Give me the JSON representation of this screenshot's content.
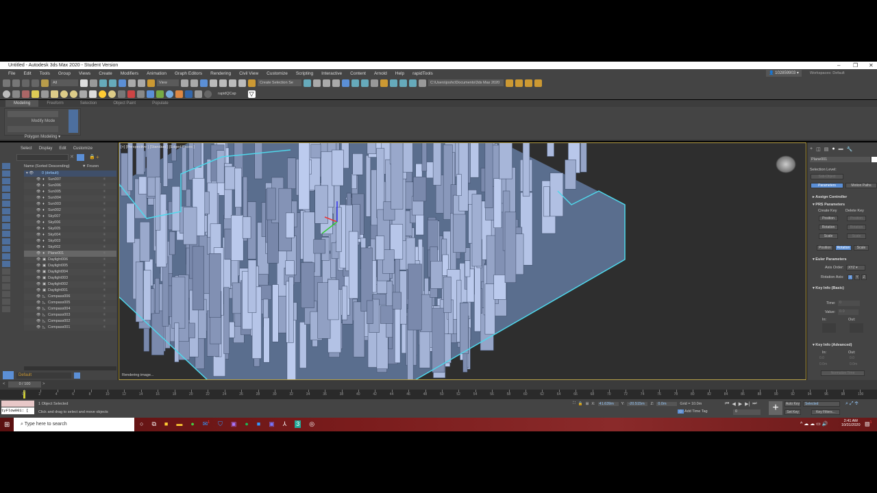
{
  "window": {
    "title": "Untitled - Autodesk 3ds Max 2020 - Student Version",
    "minimize": "–",
    "restore": "❐",
    "close": "✕"
  },
  "menu": [
    "File",
    "Edit",
    "Tools",
    "Group",
    "Views",
    "Create",
    "Modifiers",
    "Animation",
    "Graph Editors",
    "Rendering",
    "Civil View",
    "Customize",
    "Scripting",
    "Interactive",
    "Content",
    "Arnold",
    "Help",
    "rapidTools"
  ],
  "account": {
    "user": "102859903",
    "workspaces_label": "Workspaces:",
    "workspace": "Default"
  },
  "toolbar": {
    "selection_filter": "All",
    "ref_coord": "View",
    "named_selection": "Create Selection Se",
    "project_path": "C:\\Users\\joshc\\Documents\\3ds Max 2020",
    "rapid_label": "rapidQCap"
  },
  "ribbon": {
    "tabs": [
      "Modeling",
      "Freeform",
      "Selection",
      "Object Paint",
      "Populate"
    ],
    "panel_title": "Modify Mode",
    "footer": "Polygon Modeling"
  },
  "explorer": {
    "menu": [
      "Select",
      "Display",
      "Edit",
      "Customize"
    ],
    "col_name": "Name (Sorted Descending)",
    "col_frozen": "Frozen",
    "layer": "0 (default)",
    "items": [
      "Sun007",
      "Sun006",
      "Sun005",
      "Sun004",
      "Sun003",
      "Sun002",
      "Sky007",
      "Sky006",
      "Sky005",
      "Sky004",
      "Sky003",
      "Sky002",
      "Plane001",
      "Daylight006",
      "Daylight005",
      "Daylight004",
      "Daylight003",
      "Daylight002",
      "Daylight001",
      "Compass006",
      "Compass005",
      "Compass004",
      "Compass003",
      "Compass002",
      "Compass001"
    ],
    "selected": "Plane001",
    "layer_footer": "Default"
  },
  "viewport": {
    "label": "[+] [Perspective ] [Standard ] [Edged Faces ]",
    "status": "Rendering image..."
  },
  "command_panel": {
    "object_name": "Plane001",
    "selection_level": "Selection Level:",
    "sub_object": "Sub-Object",
    "tab_parameters": "Parameters",
    "tab_motion_paths": "Motion Paths",
    "assign_controller": "Assign Controller",
    "prs": "PRS Parameters",
    "create_key": "Create Key",
    "delete_key": "Delete Key",
    "position": "Position",
    "rotation": "Rotation",
    "scale": "Scale",
    "euler": "Euler Parameters",
    "axis_order_label": "Axis Order:",
    "axis_order": "XYZ",
    "rotation_axis_label": "Rotation Axis:",
    "axes": [
      "X",
      "Y",
      "Z"
    ],
    "key_info_basic": "Key Info (Basic)",
    "time_label": "Time:",
    "time": "0",
    "value_label": "Value:",
    "value": "0.0",
    "in_label": "In:",
    "out_label": "Out:",
    "key_info_adv": "Key Info (Advanced)",
    "adv_in": "0.0",
    "adv_out": "0.0",
    "adv_in2": "0.0m",
    "adv_out2": "0.0m",
    "normalize": "Normalize Time"
  },
  "timeline": {
    "frame": "0 / 100",
    "ticks": [
      "0",
      "2",
      "4",
      "6",
      "8",
      "10",
      "12",
      "14",
      "16",
      "18",
      "20",
      "22",
      "24",
      "26",
      "28",
      "30",
      "32",
      "34",
      "36",
      "38",
      "40",
      "42",
      "44",
      "46",
      "48",
      "50",
      "52",
      "54",
      "56",
      "58",
      "60",
      "62",
      "64",
      "66",
      "68",
      "70",
      "72",
      "74",
      "76",
      "78",
      "80",
      "82",
      "84",
      "86",
      "88",
      "90",
      "92",
      "94",
      "96",
      "98",
      "100"
    ]
  },
  "status": {
    "script": "tyFlow001: [",
    "selected": "1 Object Selected",
    "prompt": "Click and drag to select and move objects",
    "x_label": "X:",
    "x": "41.639m",
    "y_label": "Y:",
    "y": "-20.515m",
    "z_label": "Z:",
    "z": "0.0m",
    "grid": "Grid = 10.0m",
    "add_time_tag": "Add Time Tag",
    "current_frame": "0",
    "auto_key": "Auto Key",
    "set_key": "Set Key",
    "key_mode": "Selected",
    "key_filters": "Key Filters..."
  },
  "taskbar": {
    "search_placeholder": "Type here to search",
    "time": "2:41 AM",
    "date": "10/31/2020",
    "mail_badge": "1",
    "notif_badge": "1"
  },
  "colors": {
    "accent": "#5b8fd6",
    "selection": "#4fd8ec",
    "viewport_border": "#b8a24a"
  }
}
